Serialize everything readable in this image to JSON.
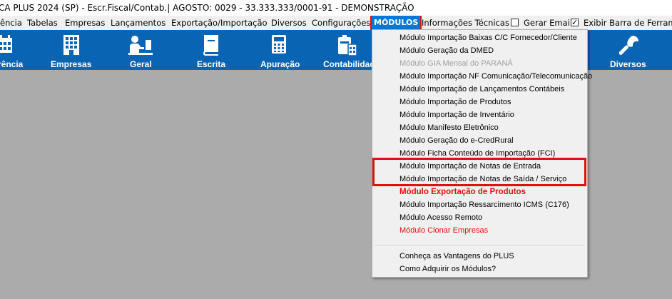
{
  "window": {
    "title": "CA PLUS 2024 (SP) - Escr.Fiscal/Contab.| AGOSTO: 0029 - 33.333.333/0001-91 - DEMONSTRAÇÃO"
  },
  "menubar": {
    "items": [
      "ência",
      "Tabelas",
      "Empresas",
      "Lançamentos",
      "Exportação/Importação",
      "Diversos",
      "Configurações"
    ],
    "active": "MÓDULOS",
    "info": "Informações Técnicas",
    "gerar_email": "Gerar Email",
    "exibir_barra": "Exibir Barra de Ferramentas",
    "gerar_email_checked": false,
    "exibir_barra_checked": true
  },
  "toolbar": {
    "background": "#0a64b4",
    "buttons": [
      {
        "label": "rência",
        "icon": "calendar-icon"
      },
      {
        "label": "Empresas",
        "icon": "building-icon"
      },
      {
        "label": "Geral",
        "icon": "user-desk-icon"
      },
      {
        "label": "Escrita",
        "icon": "book-icon"
      },
      {
        "label": "Apuração",
        "icon": "calculator-icon"
      },
      {
        "label": "Contabilidade",
        "icon": "accounting-icon"
      },
      {
        "label": "Diversos",
        "icon": "wrench-icon"
      }
    ]
  },
  "dropdown": {
    "items": [
      "Módulo Importação Baixas C/C Fornecedor/Cliente",
      "Módulo Geração da DMED",
      "Módulo GIA Mensal do PARANÁ",
      "Módulo Importação NF Comunicação/Telecomunicação",
      "Módulo Importação de Lançamentos Contábeis",
      "Módulo Importação de Produtos",
      "Módulo Importação de Inventário",
      "Módulo Manifesto Eletrônico",
      "Módulo Geração do e-CredRural",
      "Módulo Ficha Conteúdo de Importação (FCI)",
      "Módulo Importação de Notas de Entrada",
      "Módulo Importação de Notas de Saída / Serviço",
      "Módulo Exportação de Produtos",
      "Módulo Importação Ressarcimento ICMS (C176)",
      "Módulo Acesso Remoto",
      "Módulo Clonar Empresas"
    ],
    "footer": [
      "Conheça as Vantagens do PLUS",
      "Como Adquirir os Módulos?"
    ],
    "disabled_item": "Módulo GIA Mensal do PARANÁ",
    "highlight_color": "#e01010"
  }
}
